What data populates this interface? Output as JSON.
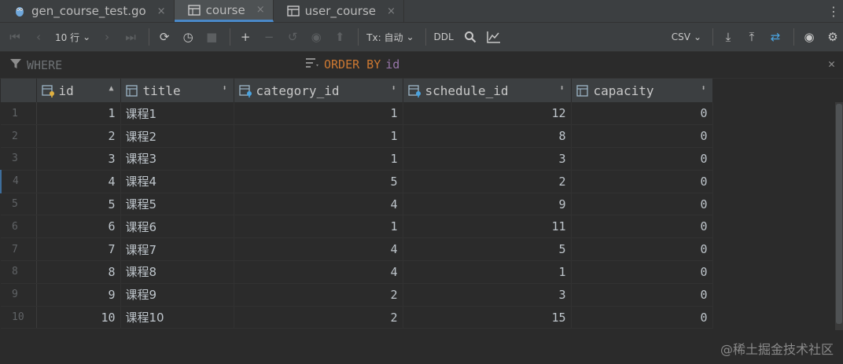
{
  "tabs": [
    {
      "label": "gen_course_test.go",
      "icon": "go-gopher-icon",
      "active": false
    },
    {
      "label": "course",
      "icon": "table-icon",
      "active": true
    },
    {
      "label": "user_course",
      "icon": "table-icon",
      "active": false
    }
  ],
  "tab_close_glyph": "×",
  "toolbar": {
    "page_size": "10 行",
    "tx_mode": "Tx: 自动",
    "ddl": "DDL",
    "export_format": "CSV"
  },
  "filter": {
    "where_label": "WHERE",
    "order_by_label": "ORDER BY",
    "order_by_value": "id"
  },
  "columns": [
    {
      "name": "id",
      "sort": "▲"
    },
    {
      "name": "title",
      "sort": "⬍"
    },
    {
      "name": "category_id",
      "sort": "⬍"
    },
    {
      "name": "schedule_id",
      "sort": "⬍"
    },
    {
      "name": "capacity",
      "sort": "⬍"
    }
  ],
  "rows": [
    {
      "rn": "1",
      "id": "1",
      "title": "课程1",
      "category_id": "1",
      "schedule_id": "12",
      "capacity": "0"
    },
    {
      "rn": "2",
      "id": "2",
      "title": "课程2",
      "category_id": "1",
      "schedule_id": "8",
      "capacity": "0"
    },
    {
      "rn": "3",
      "id": "3",
      "title": "课程3",
      "category_id": "1",
      "schedule_id": "3",
      "capacity": "0"
    },
    {
      "rn": "4",
      "id": "4",
      "title": "课程4",
      "category_id": "5",
      "schedule_id": "2",
      "capacity": "0"
    },
    {
      "rn": "5",
      "id": "5",
      "title": "课程5",
      "category_id": "4",
      "schedule_id": "9",
      "capacity": "0"
    },
    {
      "rn": "6",
      "id": "6",
      "title": "课程6",
      "category_id": "1",
      "schedule_id": "11",
      "capacity": "0"
    },
    {
      "rn": "7",
      "id": "7",
      "title": "课程7",
      "category_id": "4",
      "schedule_id": "5",
      "capacity": "0"
    },
    {
      "rn": "8",
      "id": "8",
      "title": "课程8",
      "category_id": "4",
      "schedule_id": "1",
      "capacity": "0"
    },
    {
      "rn": "9",
      "id": "9",
      "title": "课程9",
      "category_id": "2",
      "schedule_id": "3",
      "capacity": "0"
    },
    {
      "rn": "10",
      "id": "10",
      "title": "课程10",
      "category_id": "2",
      "schedule_id": "15",
      "capacity": "0"
    }
  ],
  "watermark": "@稀土掘金技术社区",
  "colors": {
    "keyword": "#cc7832",
    "identifier": "#9876aa",
    "accent": "#4a88c7"
  }
}
